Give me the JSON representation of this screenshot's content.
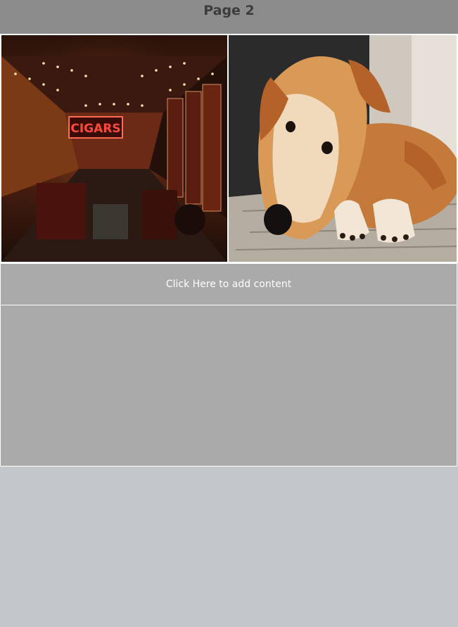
{
  "header": {
    "title": "Page 2"
  },
  "gallery": {
    "images": [
      {
        "name": "cigar-lounge-image",
        "sign_text": "CIGARS"
      },
      {
        "name": "dog-image"
      }
    ]
  },
  "content": {
    "button_label": "Click Here to add content"
  },
  "colors": {
    "header_bg": "#8c8c8c",
    "panel_bg": "#aaaaaa",
    "page_bg": "#c4c7ca",
    "neon": "#ff4a3a"
  }
}
